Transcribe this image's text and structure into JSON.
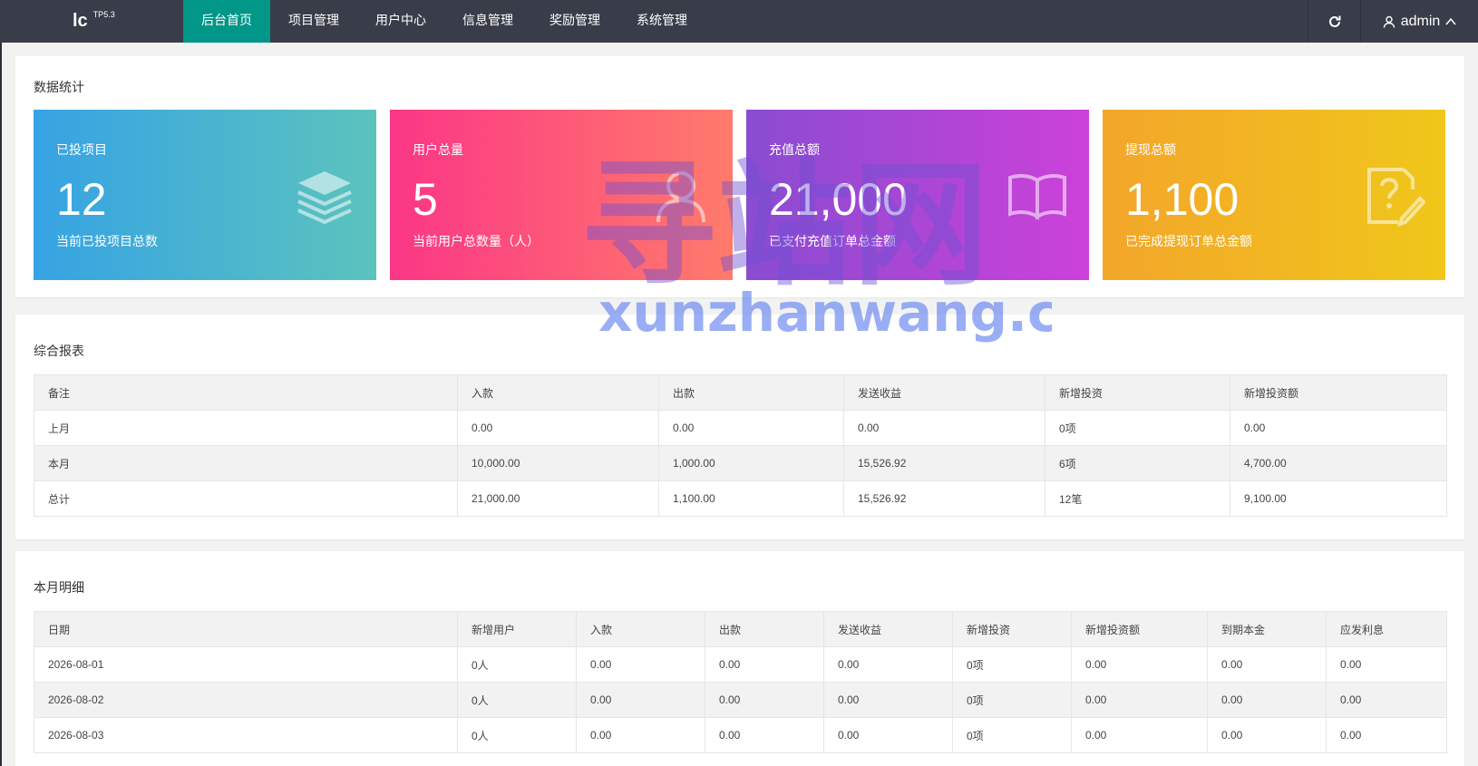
{
  "header": {
    "logo_text": "lc",
    "logo_version": "TP5.3",
    "nav": [
      "后台首页",
      "项目管理",
      "用户中心",
      "信息管理",
      "奖励管理",
      "系统管理"
    ],
    "active_nav_index": 0,
    "username": "admin"
  },
  "stats": {
    "title": "数据统计",
    "cards": [
      {
        "label": "已投项目",
        "value": "12",
        "desc": "当前已投项目总数",
        "icon": "layers-icon",
        "gradient": [
          "#36a3e4",
          "#5cc3bd"
        ]
      },
      {
        "label": "用户总量",
        "value": "5",
        "desc": "当前用户总数量（人）",
        "icon": "user-icon",
        "gradient": [
          "#fb3686",
          "#ff7b6b"
        ]
      },
      {
        "label": "充值总额",
        "value": "21,000",
        "desc": "已支付充值订单总金额",
        "icon": "book-icon",
        "gradient": [
          "#8a4cd1",
          "#cc41d9"
        ]
      },
      {
        "label": "提现总额",
        "value": "1,100",
        "desc": "已完成提现订单总金额",
        "icon": "question-edit-icon",
        "gradient": [
          "#f3a62a",
          "#f0c71a"
        ]
      }
    ]
  },
  "report": {
    "title": "综合报表",
    "headers": [
      "备注",
      "入款",
      "出款",
      "发送收益",
      "新增投资",
      "新增投资额"
    ],
    "rows": [
      [
        "上月",
        "0.00",
        "0.00",
        "0.00",
        "0项",
        "0.00"
      ],
      [
        "本月",
        "10,000.00",
        "1,000.00",
        "15,526.92",
        "6项",
        "4,700.00"
      ],
      [
        "总计",
        "21,000.00",
        "1,100.00",
        "15,526.92",
        "12笔",
        "9,100.00"
      ]
    ]
  },
  "monthly": {
    "title": "本月明细",
    "headers": [
      "日期",
      "新增用户",
      "入款",
      "出款",
      "发送收益",
      "新增投资",
      "新增投资额",
      "到期本金",
      "应发利息"
    ],
    "rows": [
      [
        "2026-08-01",
        "0人",
        "0.00",
        "0.00",
        "0.00",
        "0项",
        "0.00",
        "0.00",
        "0.00"
      ],
      [
        "2026-08-02",
        "0人",
        "0.00",
        "0.00",
        "0.00",
        "0项",
        "0.00",
        "0.00",
        "0.00"
      ],
      [
        "2026-08-03",
        "0人",
        "0.00",
        "0.00",
        "0.00",
        "0项",
        "0.00",
        "0.00",
        "0.00"
      ]
    ]
  },
  "watermark": {
    "cn": "寻站网",
    "en": "xunzhanwang.com"
  }
}
